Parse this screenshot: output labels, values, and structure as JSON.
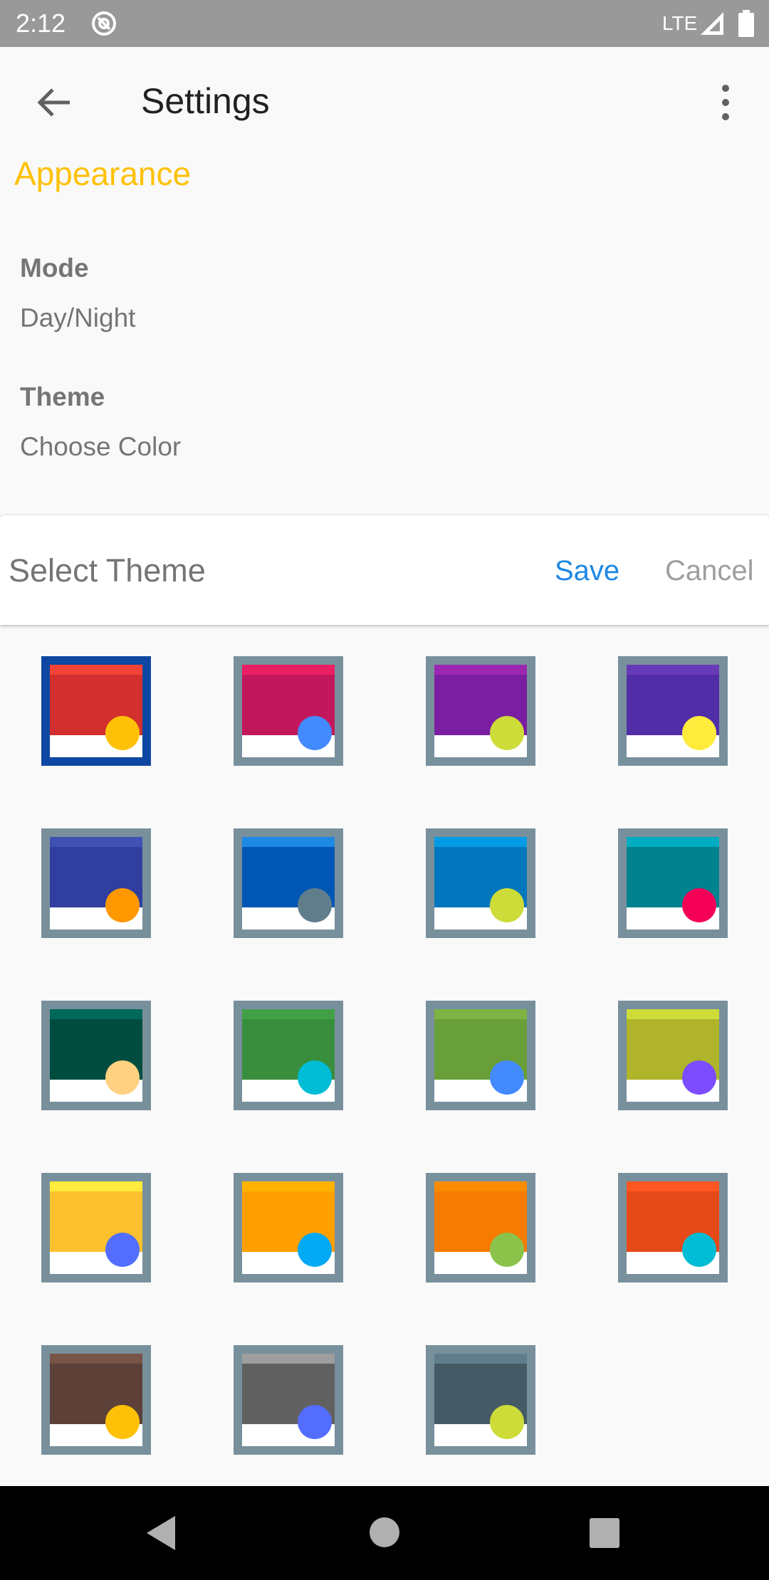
{
  "status_bar": {
    "time": "2:12",
    "network": "LTE",
    "app_icon": "at-sign-icon",
    "signal_icon": "signal-icon",
    "battery_icon": "battery-icon"
  },
  "app_bar": {
    "title": "Settings",
    "back_icon": "arrow-back-icon",
    "menu_icon": "more-vert-icon"
  },
  "preferences": {
    "section_header": "Appearance",
    "section_color": "#ffc107",
    "mode": {
      "title": "Mode",
      "summary": "Day/Night"
    },
    "theme": {
      "title": "Theme",
      "summary": "Choose Color"
    }
  },
  "dialog": {
    "title": "Select Theme",
    "save_label": "Save",
    "cancel_label": "Cancel",
    "save_color": "#1e88e5",
    "selected_border_color": "#0d47a1",
    "default_border_color": "#78909c"
  },
  "themes": [
    {
      "status": "#f44336",
      "primary": "#d32f2f",
      "accent": "#ffc107",
      "selected": true
    },
    {
      "status": "#e91e63",
      "primary": "#c2185b",
      "accent": "#448aff"
    },
    {
      "status": "#9c27b0",
      "primary": "#7b1fa2",
      "accent": "#cddc39"
    },
    {
      "status": "#673ab7",
      "primary": "#512da8",
      "accent": "#ffeb3b"
    },
    {
      "status": "#3f51b5",
      "primary": "#303f9f",
      "accent": "#ff9800"
    },
    {
      "status": "#1e88e5",
      "primary": "#0057b5",
      "accent": "#607d8b"
    },
    {
      "status": "#039be5",
      "primary": "#0277bd",
      "accent": "#cddc39"
    },
    {
      "status": "#00acc1",
      "primary": "#00838f",
      "accent": "#f50057"
    },
    {
      "status": "#00695c",
      "primary": "#004d40",
      "accent": "#ffd180"
    },
    {
      "status": "#43a047",
      "primary": "#388e3c",
      "accent": "#00bcd4"
    },
    {
      "status": "#7cb342",
      "primary": "#689f38",
      "accent": "#448aff"
    },
    {
      "status": "#cddc39",
      "primary": "#afb42b",
      "accent": "#7c4dff"
    },
    {
      "status": "#ffeb3b",
      "primary": "#fbc02d",
      "accent": "#536dfe"
    },
    {
      "status": "#ffb300",
      "primary": "#ffa000",
      "accent": "#03a9f4"
    },
    {
      "status": "#fb8c00",
      "primary": "#f57c00",
      "accent": "#8bc34a"
    },
    {
      "status": "#ff5722",
      "primary": "#e64a19",
      "accent": "#00bcd4"
    },
    {
      "status": "#795548",
      "primary": "#5d4037",
      "accent": "#ffc107"
    },
    {
      "status": "#9e9e9e",
      "primary": "#616161",
      "accent": "#536dfe"
    },
    {
      "status": "#607d8b",
      "primary": "#455a64",
      "accent": "#cddc39"
    }
  ],
  "nav_bar": {
    "back_icon": "nav-back-icon",
    "home_icon": "nav-home-icon",
    "recents_icon": "nav-recents-icon"
  }
}
